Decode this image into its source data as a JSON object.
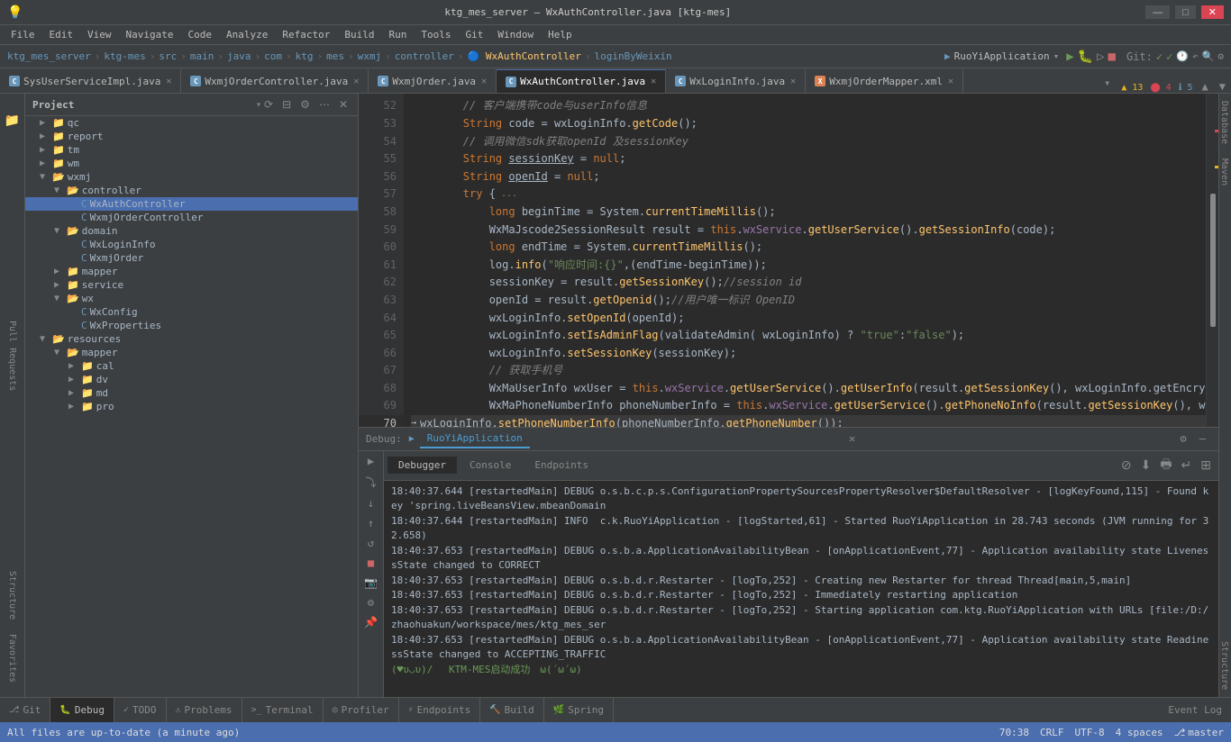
{
  "titleBar": {
    "title": "ktg_mes_server – WxAuthController.java [ktg-mes]",
    "minimize": "—",
    "maximize": "□",
    "close": "✕"
  },
  "menuBar": {
    "items": [
      "File",
      "Edit",
      "View",
      "Navigate",
      "Code",
      "Analyze",
      "Refactor",
      "Build",
      "Run",
      "Tools",
      "Git",
      "Window",
      "Help"
    ]
  },
  "pathBar": {
    "project": "ktg_mes_server",
    "module": "ktg-mes",
    "parts": [
      "src",
      "main",
      "java",
      "com",
      "ktg",
      "mes",
      "wxmj",
      "controller"
    ],
    "active": "WxAuthController",
    "method": "loginByWeixin",
    "runConfig": "RuoYiApplication"
  },
  "tabs": [
    {
      "label": "SysUserServiceImpl.java",
      "icon": "C",
      "active": false,
      "color": "#6897bb"
    },
    {
      "label": "WxmjOrderController.java",
      "icon": "C",
      "active": false,
      "color": "#6897bb"
    },
    {
      "label": "WxmjOrder.java",
      "icon": "C",
      "active": false,
      "color": "#6897bb"
    },
    {
      "label": "WxAuthController.java",
      "icon": "C",
      "active": true,
      "color": "#6897bb"
    },
    {
      "label": "WxLoginInfo.java",
      "icon": "C",
      "active": false,
      "color": "#6897bb"
    },
    {
      "label": "WxmjOrderMapper.xml",
      "icon": "X",
      "active": false,
      "color": "#da8355"
    }
  ],
  "warningCount": "▲ 13",
  "errorCount": "⬤ 4",
  "infoCount": "ℹ 5",
  "tree": {
    "projectLabel": "Project",
    "items": [
      {
        "level": 1,
        "type": "folder",
        "label": "qc",
        "expanded": false
      },
      {
        "level": 1,
        "type": "folder",
        "label": "report",
        "expanded": false
      },
      {
        "level": 1,
        "type": "folder",
        "label": "tm",
        "expanded": false
      },
      {
        "level": 1,
        "type": "folder",
        "label": "wm",
        "expanded": false
      },
      {
        "level": 1,
        "type": "folder",
        "label": "wxmj",
        "expanded": true
      },
      {
        "level": 2,
        "type": "folder",
        "label": "controller",
        "expanded": true
      },
      {
        "level": 3,
        "type": "class",
        "label": "WxAuthController",
        "selected": true,
        "color": "#6897bb"
      },
      {
        "level": 3,
        "type": "class",
        "label": "WxmjOrderController",
        "color": "#6897bb"
      },
      {
        "level": 2,
        "type": "folder",
        "label": "domain",
        "expanded": true
      },
      {
        "level": 3,
        "type": "class",
        "label": "WxLoginInfo",
        "color": "#6897bb"
      },
      {
        "level": 3,
        "type": "class",
        "label": "WxmjOrder",
        "color": "#6897bb"
      },
      {
        "level": 2,
        "type": "folder",
        "label": "mapper",
        "expanded": false
      },
      {
        "level": 2,
        "type": "folder",
        "label": "service",
        "expanded": false
      },
      {
        "level": 2,
        "type": "folder",
        "label": "wx",
        "expanded": true
      },
      {
        "level": 3,
        "type": "class",
        "label": "WxConfig",
        "color": "#6897bb"
      },
      {
        "level": 3,
        "type": "class",
        "label": "WxProperties",
        "color": "#6897bb"
      },
      {
        "level": 1,
        "type": "folder",
        "label": "resources",
        "expanded": true
      },
      {
        "level": 2,
        "type": "folder",
        "label": "mapper",
        "expanded": true
      },
      {
        "level": 3,
        "type": "folder",
        "label": "cal",
        "expanded": false
      },
      {
        "level": 3,
        "type": "folder",
        "label": "dv",
        "expanded": false
      },
      {
        "level": 3,
        "type": "folder",
        "label": "md",
        "expanded": false
      },
      {
        "level": 3,
        "type": "folder",
        "label": "pro",
        "expanded": false
      }
    ]
  },
  "codeLines": [
    {
      "num": 52,
      "content": "// 客户端高携带code与userInfo信息",
      "type": "comment"
    },
    {
      "num": 53,
      "content": "String code = wxLoginInfo.getCode();",
      "type": "code"
    },
    {
      "num": 54,
      "content": "// 调用微信sdk获取openId 及sessionKey",
      "type": "comment"
    },
    {
      "num": 55,
      "content": "String sessionKey = null;",
      "type": "code"
    },
    {
      "num": 56,
      "content": "String openId = null;",
      "type": "code"
    },
    {
      "num": 57,
      "content": "try {",
      "type": "code-try"
    },
    {
      "num": 58,
      "content": "    long beginTime = System.currentTimeMillis();",
      "type": "code"
    },
    {
      "num": 59,
      "content": "    WxMaJscode2SessionResult result = this.wxService.getUserService().getSessionInfo(code);",
      "type": "code"
    },
    {
      "num": 60,
      "content": "    long endTime = System.currentTimeMillis();",
      "type": "code"
    },
    {
      "num": 61,
      "content": "    log.info(\"响应时间:{}\",(endTime-beginTime));",
      "type": "code"
    },
    {
      "num": 62,
      "content": "    sessionKey = result.getSessionKey();//session id",
      "type": "code"
    },
    {
      "num": 63,
      "content": "    openId = result.getOpenid();//用户唯一标识 OpenID",
      "type": "code"
    },
    {
      "num": 64,
      "content": "    wxLoginInfo.setOpenId(openId);",
      "type": "code"
    },
    {
      "num": 65,
      "content": "    wxLoginInfo.setIsAdminFlag(validateAdmin( wxLoginInfo) ? \"true\":\"false\");",
      "type": "code"
    },
    {
      "num": 66,
      "content": "    wxLoginInfo.setSessionKey(sessionKey);",
      "type": "code"
    },
    {
      "num": 67,
      "content": "    // 获取手机号",
      "type": "comment"
    },
    {
      "num": 68,
      "content": "    WxMaUserInfo wxUser = this.wxService.getUserService().getUserInfo(result.getSessionKey(), wxLoginInfo.getEncrypt",
      "type": "code"
    },
    {
      "num": 69,
      "content": "    WxMaPhoneNumberInfo phoneNumberInfo = this.wxService.getUserService().getPhoneNoInfo(result.getSessionKey(), wxL",
      "type": "code"
    },
    {
      "num": 70,
      "content": "    wxLoginInfo.setPhoneNumberInfo(phoneNumberInfo.getPhoneNumber());",
      "type": "code",
      "highlighted": true
    },
    {
      "num": 71,
      "content": "    wxLoginInfo.setUserInfo(wxUser);",
      "type": "code"
    }
  ],
  "debugPanel": {
    "title": "Debug",
    "runConfig": "RuoYiApplication",
    "tabs": [
      "Debugger",
      "Console",
      "Endpoints"
    ],
    "activeTab": "Console",
    "consoleLines": [
      {
        "text": "18:40:37.644 [restartedMain] DEBUG o.s.b.c.p.s.ConfigurationPropertySourcesPropertyResolver$DefaultResolver - [logKeyFound,115] - Found key 'spring.liveBeansView.mbeanDomain",
        "type": "debug"
      },
      {
        "text": "18:40:37.644 [restartedMain] INFO  c.k.RuoYiApplication - [logStarted,61] - Started RuoYiApplication in 28.743 seconds (JVM running for 32.658)",
        "type": "info"
      },
      {
        "text": "18:40:37.653 [restartedMain] DEBUG o.s.b.a.ApplicationAvailabilityBean - [onApplicationEvent,77] - Application availability state LivenessState changed to CORRECT",
        "type": "debug"
      },
      {
        "text": "18:40:37.653 [restartedMain] DEBUG o.s.b.d.r.Restarter - [logTo,252] - Creating new Restarter for thread Thread[main,5,main]",
        "type": "debug"
      },
      {
        "text": "18:40:37.653 [restartedMain] DEBUG o.s.b.d.r.Restarter - [logTo,252] - Immediately restarting application",
        "type": "debug"
      },
      {
        "text": "18:40:37.653 [restartedMain] DEBUG o.s.b.d.r.Restarter - [logTo,252] - Starting application com.ktg.RuoYiApplication with URLs [file:/D:/zhaohuakun/workspace/mes/ktg_mes_ser",
        "type": "debug"
      },
      {
        "text": "18:40:37.653 [restartedMain] DEBUG o.s.b.a.ApplicationAvailabilityBean - [onApplicationEvent,77] - Application availability state ReadinessState changed to ACCEPTING_TRAFFIC",
        "type": "debug"
      },
      {
        "text": "(♥υ◡υ)/ 　KTM-MES启动成功　ω(ʴωʴω)",
        "type": "success"
      }
    ]
  },
  "bottomTabs": [
    {
      "label": "Git",
      "icon": "⎇",
      "active": false
    },
    {
      "label": "Debug",
      "icon": "🐛",
      "active": true
    },
    {
      "label": "TODO",
      "icon": "✓",
      "active": false
    },
    {
      "label": "Problems",
      "icon": "⚠",
      "active": false
    },
    {
      "label": "Terminal",
      "icon": ">_",
      "active": false
    },
    {
      "label": "Profiler",
      "icon": "◎",
      "active": false
    },
    {
      "label": "Endpoints",
      "icon": "⚡",
      "active": false
    },
    {
      "label": "Build",
      "icon": "🔨",
      "active": false
    },
    {
      "label": "Spring",
      "icon": "🌿",
      "active": false
    }
  ],
  "statusBar": {
    "gitBranch": "master",
    "lineCol": "70:38",
    "lineEnding": "CRLF",
    "encoding": "UTF-8",
    "indent": "4 spaces",
    "message": "All files are up-to-date (a minute ago)"
  },
  "rightPanels": [
    "Database",
    "Maven",
    "Structure"
  ]
}
